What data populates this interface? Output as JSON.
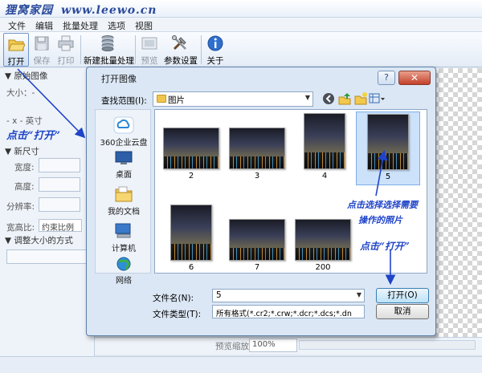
{
  "site": {
    "title": "狸窝家园",
    "url": "www.leewo.cn"
  },
  "menu": [
    "文件",
    "编辑",
    "批量处理",
    "选项",
    "视图"
  ],
  "toolbar": {
    "open": "打开",
    "save": "保存",
    "print": "打印",
    "batch": "新建批量处理",
    "preview": "预览",
    "settings": "参数设置",
    "about": "关于"
  },
  "left_panel": {
    "original_header": "▼ 原始图像",
    "size_label": "大小：-",
    "dim_label": "- x - 英寸",
    "new_size_header": "▼ 新尺寸",
    "width_label": "宽度:",
    "height_label": "高度:",
    "resolution_label": "分辨率:",
    "ratio_label": "宽高比:",
    "ratio_value": "约束比例",
    "resize_header": "▼ 调整大小的方式"
  },
  "bottom": {
    "preview_zoom_label": "预览缩放:",
    "zoom_value": "100%"
  },
  "dialog": {
    "title": "打开图像",
    "look_in_label": "查找范围(I):",
    "look_in_value": "图片",
    "places": [
      "360企业云盘",
      "桌面",
      "我的文档",
      "计算机",
      "网络"
    ],
    "files": [
      "2",
      "3",
      "4",
      "5",
      "6",
      "7",
      "200"
    ],
    "selected_file": "5",
    "filename_label": "文件名(N):",
    "filename_value": "5",
    "filetype_label": "文件类型(T):",
    "filetype_value": "所有格式(*.cr2;*.crw;*.dcr;*.dcs;*.dn",
    "open_button": "打开(O)",
    "cancel_button": "取消",
    "help_button": "?",
    "close_button": "✕"
  },
  "annotations": {
    "click_open_left": "点击“打开”",
    "select_photo": "点击选择选择需要",
    "select_photo_line2": "操作的照片",
    "click_open_right": "点击“打开”"
  },
  "colors": {
    "annotation_blue": "#1f44c9",
    "selection_blue": "#cce2fb",
    "close_red": "#c4412b"
  }
}
